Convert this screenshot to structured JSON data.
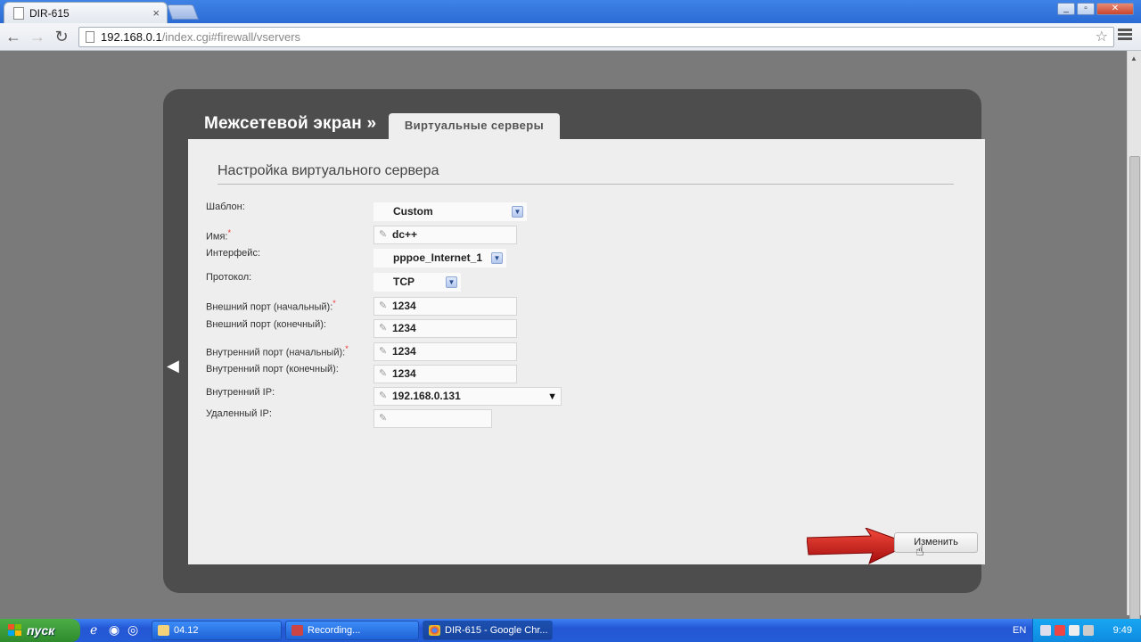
{
  "browser": {
    "tab_title": "DIR-615",
    "tab_close": "×",
    "url_host": "192.168.0.1",
    "url_path": "/index.cgi#firewall/vservers",
    "win_controls": [
      "_",
      "▫",
      "✕"
    ]
  },
  "page": {
    "breadcrumb": "Межсетевой экран »",
    "tab_label": "Виртуальные серверы",
    "section_title": "Настройка виртуального сервера",
    "fields": {
      "template": {
        "label": "Шаблон:",
        "value": "Custom"
      },
      "name": {
        "label": "Имя:",
        "required": "*",
        "value": "dc++"
      },
      "interface": {
        "label": "Интерфейс:",
        "value": "pppoe_Internet_1"
      },
      "protocol": {
        "label": "Протокол:",
        "value": "TCP"
      },
      "ext_port_start": {
        "label": "Внешний порт (начальный):",
        "required": "*",
        "value": "1234"
      },
      "ext_port_end": {
        "label": "Внешний порт (конечный):",
        "value": "1234"
      },
      "int_port_start": {
        "label": "Внутренний порт (начальный):",
        "required": "*",
        "value": "1234"
      },
      "int_port_end": {
        "label": "Внутренний порт (конечный):",
        "value": "1234"
      },
      "internal_ip": {
        "label": "Внутренний IP:",
        "value": "192.168.0.131"
      },
      "remote_ip": {
        "label": "Удаленный IP:",
        "value": ""
      }
    },
    "change_button": "Изменить"
  },
  "taskbar": {
    "start_label": "пуск",
    "tasks": [
      {
        "label": "04.12"
      },
      {
        "label": "Recording..."
      },
      {
        "label": "DIR-615 - Google Chr..."
      }
    ],
    "language": "EN",
    "clock": "9:49"
  },
  "colors": {
    "frame": "#4d4d4d",
    "panel": "#eeeeee",
    "background": "#7a7a7a",
    "taskbar": "#245cd8",
    "start": "#3a9b36",
    "red_arrow": "#d11a1a"
  }
}
